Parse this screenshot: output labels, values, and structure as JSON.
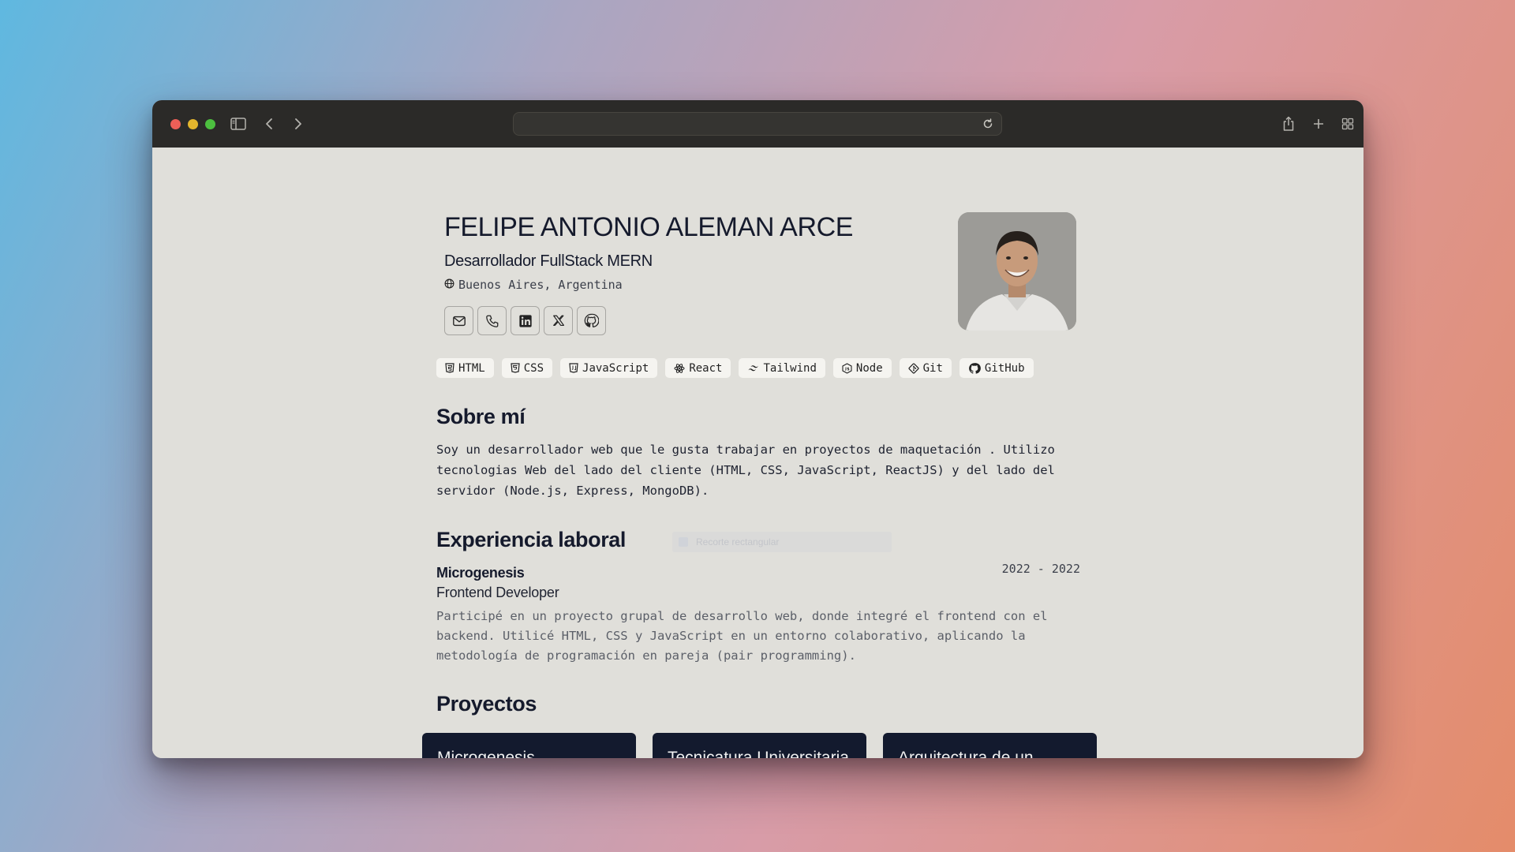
{
  "browser": {
    "address": "",
    "icons": [
      "sidebar-icon",
      "back-icon",
      "forward-icon",
      "reload-icon",
      "share-icon",
      "new-tab-icon",
      "tab-overview-icon"
    ]
  },
  "profile": {
    "name": "FELIPE ANTONIO ALEMAN ARCE",
    "role": "Desarrollador FullStack MERN",
    "location": "Buenos Aires, Argentina",
    "socials": [
      "email-icon",
      "phone-icon",
      "linkedin-icon",
      "x-icon",
      "github-icon"
    ]
  },
  "skills": [
    {
      "label": "HTML",
      "icon": "html5-icon"
    },
    {
      "label": "CSS",
      "icon": "css3-icon"
    },
    {
      "label": "JavaScript",
      "icon": "javascript-icon"
    },
    {
      "label": "React",
      "icon": "react-icon"
    },
    {
      "label": "Tailwind",
      "icon": "tailwind-icon"
    },
    {
      "label": "Node",
      "icon": "node-icon"
    },
    {
      "label": "Git",
      "icon": "git-icon"
    },
    {
      "label": "GitHub",
      "icon": "github-icon"
    }
  ],
  "about": {
    "title": "Sobre mí",
    "text": "Soy un desarrollador web que le gusta trabajar en proyectos de maquetación . Utilizo tecnologias Web del lado del cliente (HTML, CSS, JavaScript, ReactJS) y del lado del servidor (Node.js, Express, MongoDB)."
  },
  "experience": {
    "title": "Experiencia laboral",
    "company": "Microgenesis",
    "dates": "2022 - 2022",
    "position": "Frontend Developer",
    "description": "Participé en un proyecto grupal de desarrollo web, donde integré el frontend con el backend. Utilicé HTML, CSS y JavaScript en un entorno colaborativo, aplicando la metodología de programación en pareja (pair programming)."
  },
  "overlay": {
    "label": "Recorte rectangular"
  },
  "projects": {
    "title": "Proyectos",
    "items": [
      "Microgenesis",
      "Tecnicatura Universitaria",
      "Arquitectura de un"
    ]
  }
}
